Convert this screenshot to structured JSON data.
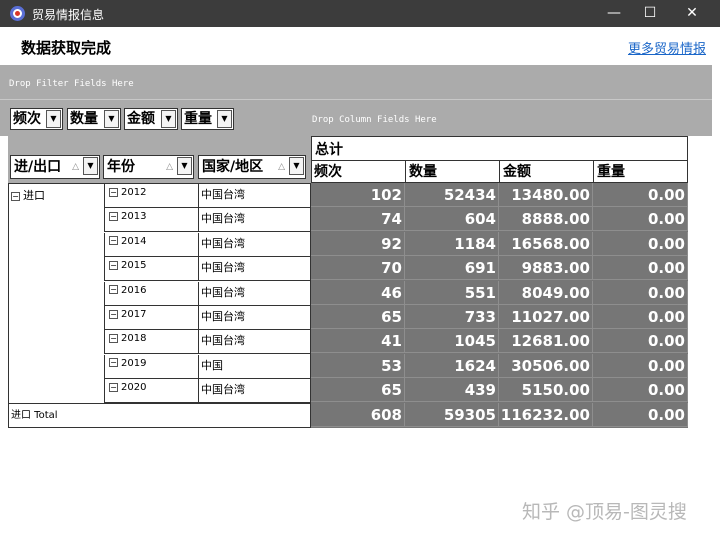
{
  "window": {
    "title": "贸易情报信息",
    "minimize": "—",
    "maximize": "☐",
    "close": "✕"
  },
  "header": {
    "status": "数据获取完成",
    "more_link": "更多贸易情报"
  },
  "pivot": {
    "filter_hint": "Drop Filter Fields Here",
    "column_hint": "Drop Column Fields Here",
    "data_fields": [
      "频次",
      "数量",
      "金额",
      "重量"
    ],
    "row_fields": [
      "进/出口",
      "年份",
      "国家/地区"
    ],
    "grand_total_label": "总计",
    "column_headers": [
      "频次",
      "数量",
      "金额",
      "重量"
    ],
    "group": {
      "label": "进口",
      "total_label": "进口 Total"
    },
    "rows": [
      {
        "year": "2012",
        "country": "中国台湾",
        "freq": "102",
        "qty": "52434",
        "amount": "13480.00",
        "weight": "0.00"
      },
      {
        "year": "2013",
        "country": "中国台湾",
        "freq": "74",
        "qty": "604",
        "amount": "8888.00",
        "weight": "0.00"
      },
      {
        "year": "2014",
        "country": "中国台湾",
        "freq": "92",
        "qty": "1184",
        "amount": "16568.00",
        "weight": "0.00"
      },
      {
        "year": "2015",
        "country": "中国台湾",
        "freq": "70",
        "qty": "691",
        "amount": "9883.00",
        "weight": "0.00"
      },
      {
        "year": "2016",
        "country": "中国台湾",
        "freq": "46",
        "qty": "551",
        "amount": "8049.00",
        "weight": "0.00"
      },
      {
        "year": "2017",
        "country": "中国台湾",
        "freq": "65",
        "qty": "733",
        "amount": "11027.00",
        "weight": "0.00"
      },
      {
        "year": "2018",
        "country": "中国台湾",
        "freq": "41",
        "qty": "1045",
        "amount": "12681.00",
        "weight": "0.00"
      },
      {
        "year": "2019",
        "country": "中国",
        "freq": "53",
        "qty": "1624",
        "amount": "30506.00",
        "weight": "0.00"
      },
      {
        "year": "2020",
        "country": "中国台湾",
        "freq": "65",
        "qty": "439",
        "amount": "5150.00",
        "weight": "0.00"
      }
    ],
    "totals": {
      "freq": "608",
      "qty": "59305",
      "amount": "116232.00",
      "weight": "0.00"
    }
  },
  "watermark": "知乎 @顶易-图灵搜",
  "colors": {
    "titlebar": "#3c3c3c",
    "link": "#1a66c8",
    "pivot_bg": "#ababab",
    "data_bg": "#767676"
  },
  "icons": {
    "app": "app-logo-icon",
    "expand": "collapse-box-icon",
    "dropdown": "dropdown-arrow-icon",
    "sort": "sort-arrow-icon"
  }
}
